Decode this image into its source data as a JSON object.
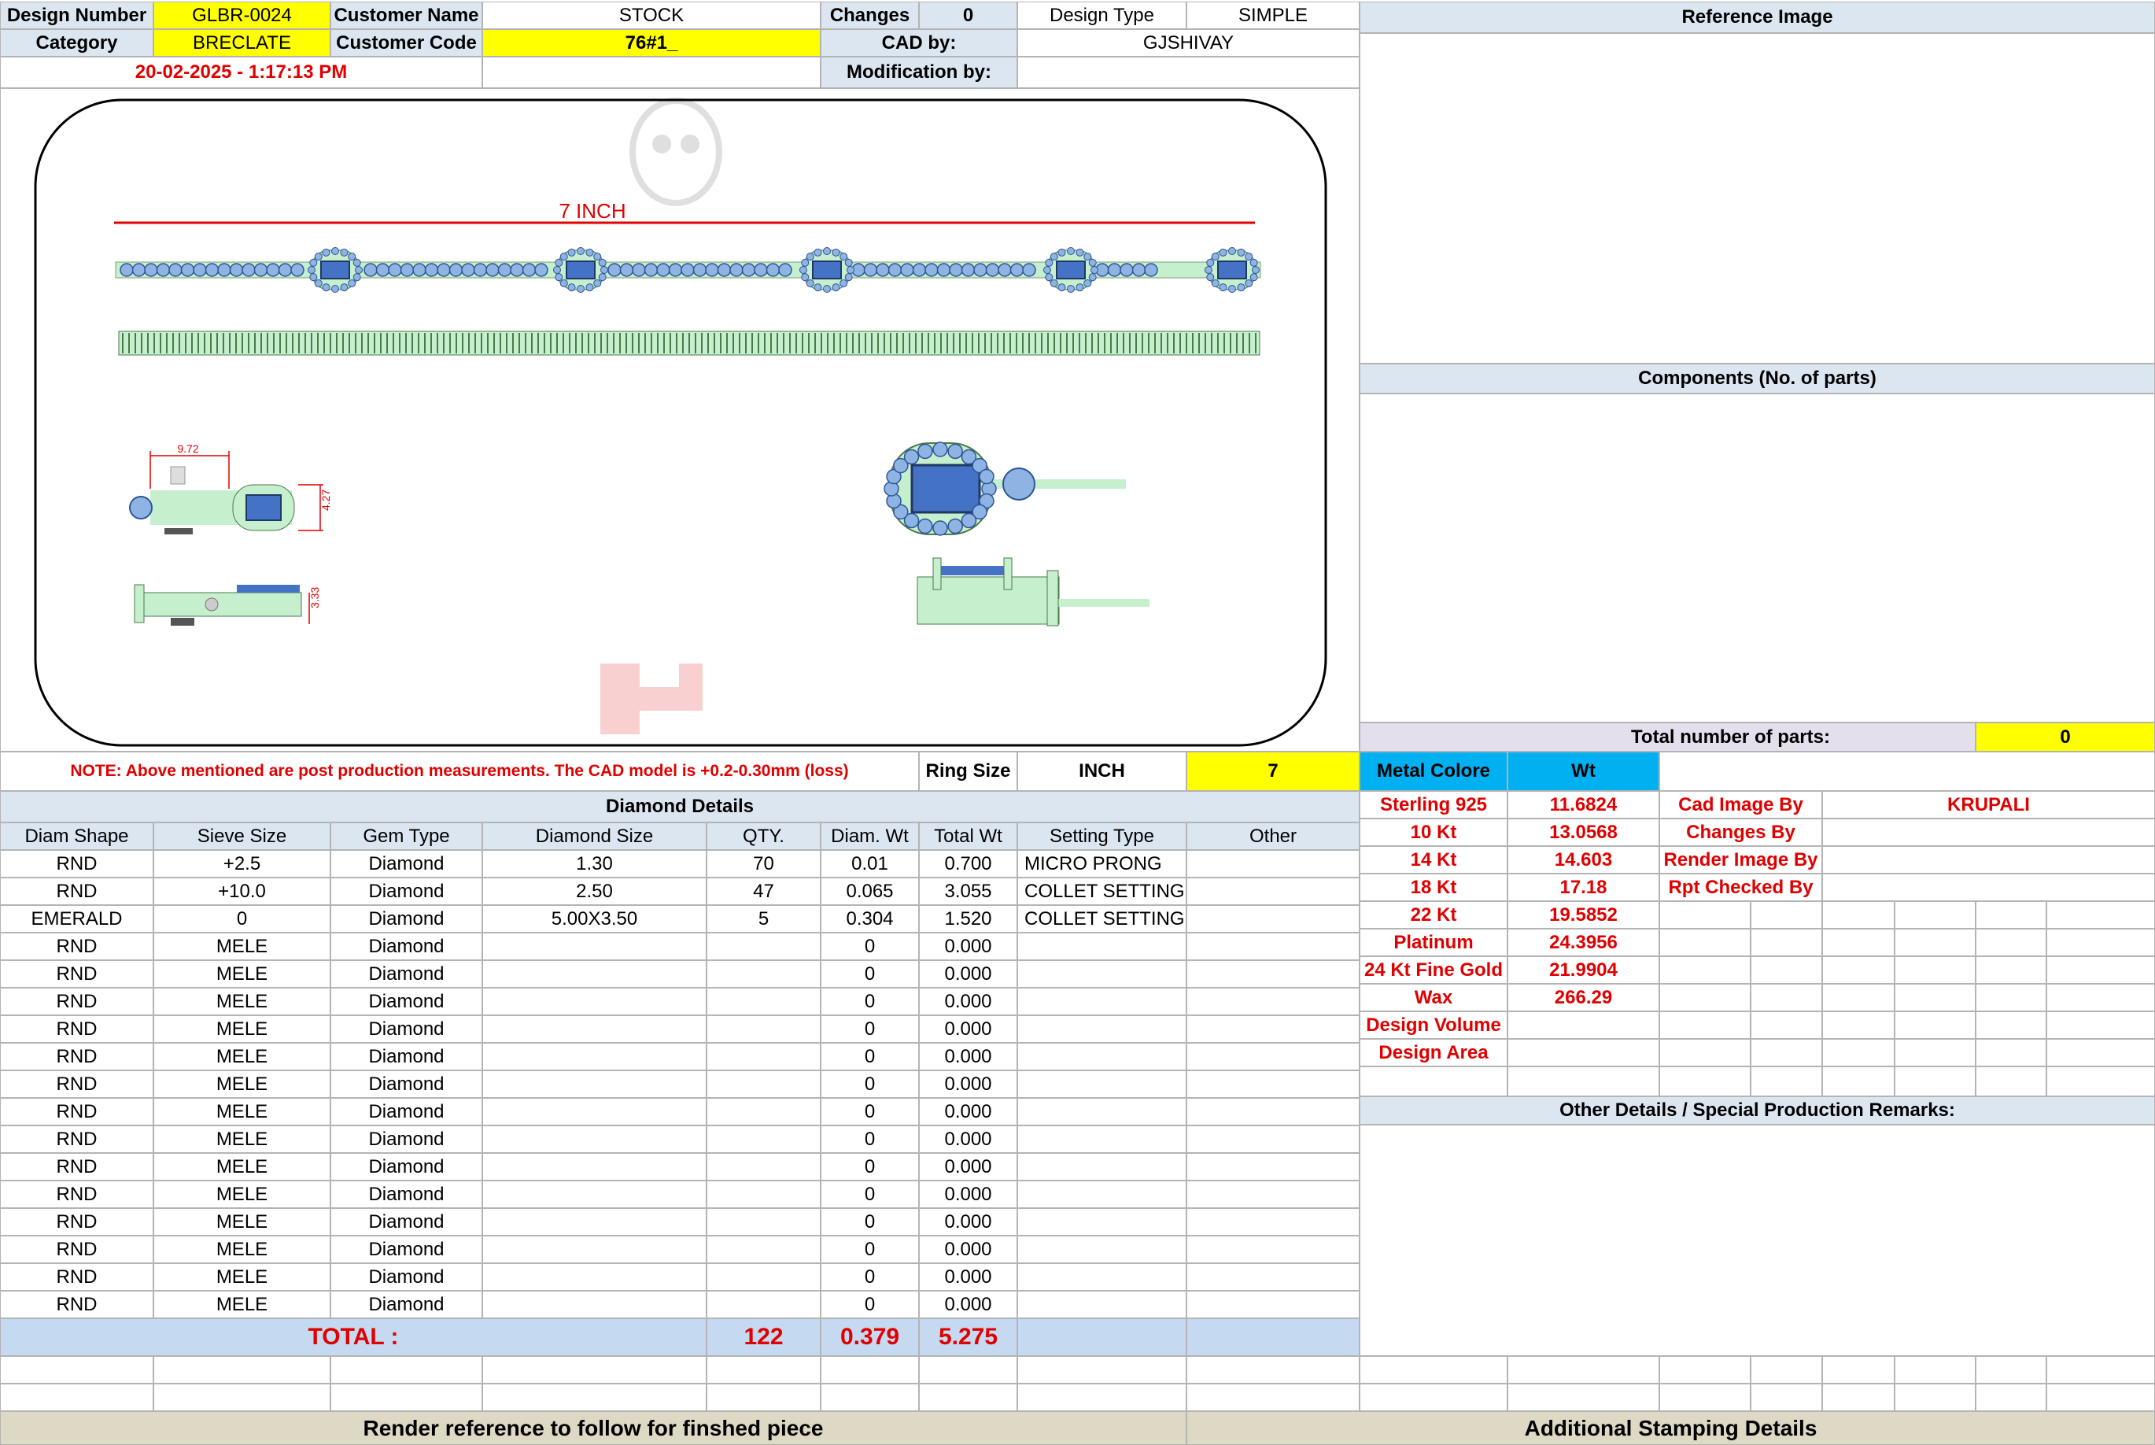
{
  "header": {
    "design_number_label": "Design Number",
    "design_number": "GLBR-0024",
    "customer_name_label": "Customer Name",
    "customer_name": "STOCK",
    "changes_label": "Changes",
    "changes": "0",
    "design_type_label": "Design Type",
    "design_type": "SIMPLE",
    "category_label": "Category",
    "category": "BRECLATE",
    "customer_code_label": "Customer Code",
    "customer_code": "76#1_",
    "cad_by_label": "CAD by:",
    "cad_by": "GJSHIVAY",
    "timestamp": "20-02-2025 - 1:17:13 PM",
    "modification_by_label": "Modification by:",
    "modification_by": ""
  },
  "drawing": {
    "length_label": "7 INCH",
    "dim_width": "9.72",
    "dim_height": "4.27",
    "dim_depth": "3.33"
  },
  "note": "NOTE: Above mentioned are post production measurements. The CAD model is +0.2-0.30mm (loss)",
  "ring_size": {
    "label": "Ring Size",
    "unit": "INCH",
    "value": "7"
  },
  "right_panel": {
    "reference_image_label": "Reference Image",
    "components_label": "Components (No. of parts)",
    "total_parts_label": "Total number of parts:",
    "total_parts": "0",
    "metal_colore_label": "Metal Colore",
    "wt_label": "Wt",
    "other_details_label": "Other Details / Special Production Remarks:"
  },
  "metals": [
    {
      "name": "Sterling 925",
      "wt": "11.6824"
    },
    {
      "name": "10 Kt",
      "wt": "13.0568"
    },
    {
      "name": "14 Kt",
      "wt": "14.603"
    },
    {
      "name": "18 Kt",
      "wt": "17.18"
    },
    {
      "name": "22 Kt",
      "wt": "19.5852"
    },
    {
      "name": "Platinum",
      "wt": "24.3956"
    },
    {
      "name": "24 Kt Fine Gold",
      "wt": "21.9904"
    },
    {
      "name": "Wax",
      "wt": "266.29"
    },
    {
      "name": "Design Volume",
      "wt": ""
    },
    {
      "name": "Design Area",
      "wt": ""
    }
  ],
  "credits": [
    {
      "label": "Cad Image By",
      "value": "KRUPALI"
    },
    {
      "label": "Changes By",
      "value": ""
    },
    {
      "label": "Render Image By",
      "value": ""
    },
    {
      "label": "Rpt Checked By",
      "value": ""
    }
  ],
  "diamond_details": {
    "title": "Diamond Details",
    "columns": [
      "Diam Shape",
      "Sieve Size",
      "Gem Type",
      "Diamond Size",
      "QTY.",
      "Diam. Wt",
      "Total Wt",
      "Setting Type",
      "Other"
    ],
    "rows": [
      [
        "RND",
        "+2.5",
        "Diamond",
        "1.30",
        "70",
        "0.01",
        "0.700",
        "MICRO PRONG",
        ""
      ],
      [
        "RND",
        "+10.0",
        "Diamond",
        "2.50",
        "47",
        "0.065",
        "3.055",
        "COLLET SETTING",
        ""
      ],
      [
        "EMERALD",
        "0",
        "Diamond",
        "5.00X3.50",
        "5",
        "0.304",
        "1.520",
        "COLLET SETTING",
        ""
      ],
      [
        "RND",
        "MELE",
        "Diamond",
        "",
        "",
        "0",
        "0.000",
        "",
        ""
      ],
      [
        "RND",
        "MELE",
        "Diamond",
        "",
        "",
        "0",
        "0.000",
        "",
        ""
      ],
      [
        "RND",
        "MELE",
        "Diamond",
        "",
        "",
        "0",
        "0.000",
        "",
        ""
      ],
      [
        "RND",
        "MELE",
        "Diamond",
        "",
        "",
        "0",
        "0.000",
        "",
        ""
      ],
      [
        "RND",
        "MELE",
        "Diamond",
        "",
        "",
        "0",
        "0.000",
        "",
        ""
      ],
      [
        "RND",
        "MELE",
        "Diamond",
        "",
        "",
        "0",
        "0.000",
        "",
        ""
      ],
      [
        "RND",
        "MELE",
        "Diamond",
        "",
        "",
        "0",
        "0.000",
        "",
        ""
      ],
      [
        "RND",
        "MELE",
        "Diamond",
        "",
        "",
        "0",
        "0.000",
        "",
        ""
      ],
      [
        "RND",
        "MELE",
        "Diamond",
        "",
        "",
        "0",
        "0.000",
        "",
        ""
      ],
      [
        "RND",
        "MELE",
        "Diamond",
        "",
        "",
        "0",
        "0.000",
        "",
        ""
      ],
      [
        "RND",
        "MELE",
        "Diamond",
        "",
        "",
        "0",
        "0.000",
        "",
        ""
      ],
      [
        "RND",
        "MELE",
        "Diamond",
        "",
        "",
        "0",
        "0.000",
        "",
        ""
      ],
      [
        "RND",
        "MELE",
        "Diamond",
        "",
        "",
        "0",
        "0.000",
        "",
        ""
      ],
      [
        "RND",
        "MELE",
        "Diamond",
        "",
        "",
        "0",
        "0.000",
        "",
        ""
      ]
    ],
    "total_label": "TOTAL :",
    "total_qty": "122",
    "total_diam_wt": "0.379",
    "total_wt": "5.275"
  },
  "footer": {
    "render_reference": "Render reference to follow for finshed piece",
    "stamping_details": "Additional Stamping Details"
  },
  "colors": {
    "yellow": "#ffff00",
    "header_blue": "#dce6f1",
    "total_blue": "#c5d9f1",
    "metal_header": "#00b0f0",
    "red": "#e00000",
    "jewel_blue": "#4472c4",
    "metal_green": "#c6efce"
  }
}
